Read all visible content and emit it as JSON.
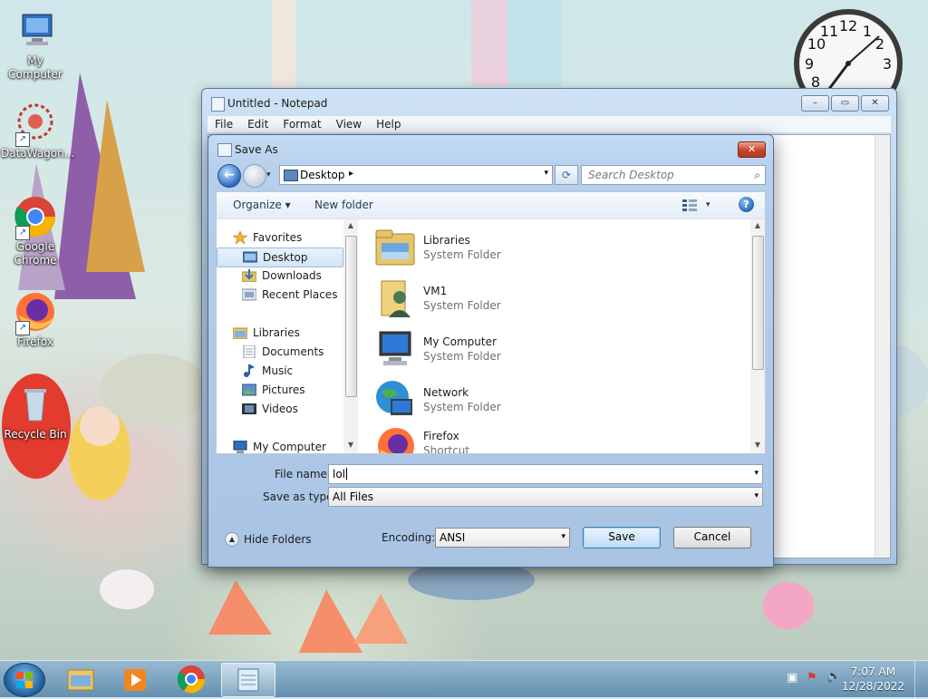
{
  "desktop": {
    "icons": [
      {
        "label": "My Computer"
      },
      {
        "label": "DataWagon..."
      },
      {
        "label": "Google Chrome"
      },
      {
        "label": "Firefox"
      },
      {
        "label": "Recycle Bin"
      }
    ],
    "clock": {
      "numbers": [
        "12",
        "1",
        "2",
        "3",
        "8",
        "9",
        "10",
        "11"
      ]
    }
  },
  "notepad": {
    "title": "Untitled - Notepad",
    "menu": [
      "File",
      "Edit",
      "Format",
      "View",
      "Help"
    ],
    "caption_buttons": {
      "minimize": "–",
      "maximize": "▭",
      "close": "✕"
    }
  },
  "dialog": {
    "title": "Save As",
    "close": "✕",
    "nav": {
      "back": "←",
      "dropdown": "▾"
    },
    "address": {
      "location": "Desktop",
      "separator": "▸",
      "dropdown": "▾"
    },
    "refresh": "⟳",
    "search": {
      "placeholder": "Search Desktop",
      "icon": "⌕"
    },
    "toolbar": {
      "organize": "Organize ▾",
      "new_folder": "New folder",
      "views_dropdown": "▾",
      "help": "?"
    },
    "nav_pane": [
      {
        "label": "Favorites",
        "icon": "star-icon"
      },
      {
        "label": "Desktop",
        "icon": "desktop-icon",
        "selected": true
      },
      {
        "label": "Downloads",
        "icon": "downloads-icon"
      },
      {
        "label": "Recent Places",
        "icon": "recent-places-icon"
      },
      {
        "label": "Libraries",
        "icon": "libraries-icon"
      },
      {
        "label": "Documents",
        "icon": "documents-icon"
      },
      {
        "label": "Music",
        "icon": "music-icon"
      },
      {
        "label": "Pictures",
        "icon": "pictures-icon"
      },
      {
        "label": "Videos",
        "icon": "videos-icon"
      },
      {
        "label": "My Computer",
        "icon": "computer-icon"
      }
    ],
    "files": [
      {
        "name": "Libraries",
        "type": "System Folder"
      },
      {
        "name": "VM1",
        "type": "System Folder"
      },
      {
        "name": "My Computer",
        "type": "System Folder"
      },
      {
        "name": "Network",
        "type": "System Folder"
      },
      {
        "name": "Firefox",
        "type": "Shortcut"
      }
    ],
    "file_name": {
      "label": "File name:",
      "value": "lol"
    },
    "save_as_type": {
      "label": "Save as type:",
      "value": "All Files"
    },
    "encoding": {
      "label": "Encoding:",
      "value": "ANSI"
    },
    "hide_folders": {
      "label": "Hide Folders",
      "icon": "▲"
    },
    "buttons": {
      "save": "Save",
      "cancel": "Cancel"
    },
    "scroll_arrows": {
      "up": "▲",
      "down": "▼"
    }
  },
  "taskbar": {
    "time": "7:07 AM",
    "date": "12/28/2022",
    "tray": {
      "network": "▣",
      "flag": "⚑",
      "volume": "🔈"
    }
  },
  "colors": {
    "accent": "#2e6cc1",
    "title_close": "#c6452d"
  }
}
